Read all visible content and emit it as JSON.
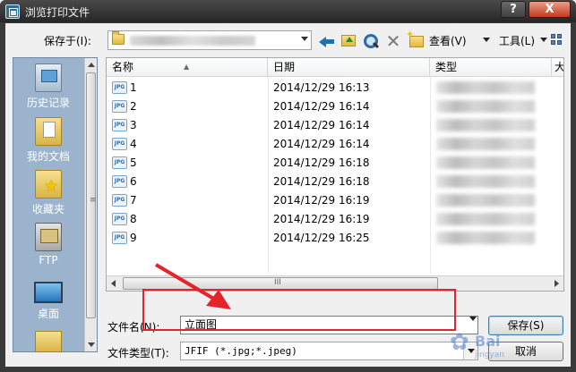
{
  "window": {
    "title": "浏览打印文件",
    "help_label": "?",
    "close_label": "X"
  },
  "toolbar": {
    "save_in_label": "保存于(I):",
    "save_in_value": "",
    "view_menu_label": "查看(V)",
    "tools_menu_label": "工具(L)"
  },
  "places": {
    "items": [
      {
        "label": "历史记录",
        "icon": "history-icon"
      },
      {
        "label": "我的文档",
        "icon": "my-documents-icon"
      },
      {
        "label": "收藏夹",
        "icon": "favorites-icon"
      },
      {
        "label": "FTP",
        "icon": "ftp-icon"
      },
      {
        "label": "桌面",
        "icon": "desktop-icon"
      }
    ]
  },
  "file_list": {
    "columns": [
      "名称",
      "日期",
      "类型",
      "大"
    ],
    "icon_badge": "JPG",
    "rows": [
      {
        "name": "1",
        "date": "2014/12/29 16:13"
      },
      {
        "name": "2",
        "date": "2014/12/29 16:14"
      },
      {
        "name": "3",
        "date": "2014/12/29 16:14"
      },
      {
        "name": "4",
        "date": "2014/12/29 16:14"
      },
      {
        "name": "5",
        "date": "2014/12/29 16:18"
      },
      {
        "name": "6",
        "date": "2014/12/29 16:18"
      },
      {
        "name": "7",
        "date": "2014/12/29 16:19"
      },
      {
        "name": "8",
        "date": "2014/12/29 16:19"
      },
      {
        "name": "9",
        "date": "2014/12/29 16:25"
      }
    ],
    "scroll_grip": "III"
  },
  "form": {
    "filename_label": "文件名(N):",
    "filename_value": "立面图",
    "filetype_label": "文件类型(T):",
    "filetype_value": "JFIF (*.jpg;*.jpeg)",
    "save_button": "保存(S)",
    "cancel_button": "取消"
  },
  "watermark": {
    "text": "Bai",
    "sub": "jingyan"
  },
  "colors": {
    "annotation": "#e5232a",
    "places_bg": "#9bb3cc"
  }
}
